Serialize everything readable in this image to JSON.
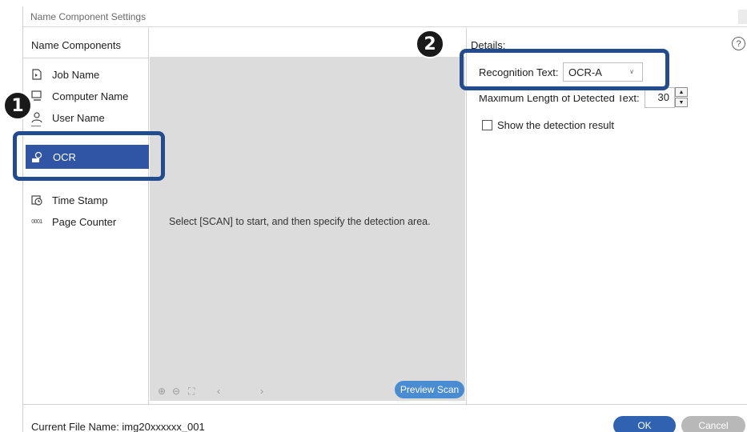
{
  "window": {
    "title": "Name Component Settings"
  },
  "left_panel": {
    "header": "Name Components",
    "items": [
      {
        "label": "Job Name",
        "icon": "document-icon"
      },
      {
        "label": "Computer Name",
        "icon": "computer-icon"
      },
      {
        "label": "User Name",
        "icon": "user-icon"
      },
      {
        "label": "OCR",
        "icon": "ocr-icon",
        "selected": true
      },
      {
        "label": "Time Stamp",
        "icon": "clock-icon"
      },
      {
        "label": "Page Counter",
        "icon": "counter-icon"
      }
    ]
  },
  "preview": {
    "message": "Select [SCAN] to start, and then specify the detection area.",
    "tools": {
      "zoom_in": "⊕",
      "zoom_out": "⊖",
      "fit": "⛶",
      "prev": "‹",
      "next": "›"
    },
    "preview_scan_label": "Preview Scan"
  },
  "details": {
    "label": "Details:",
    "help": "?",
    "recognition_text_label": "Recognition Text:",
    "recognition_text_value": "OCR-A",
    "max_length_label": "Maximum Length of Detected Text:",
    "max_length_value": "30",
    "show_detection_label": "Show the detection result",
    "show_detection_checked": false
  },
  "footer": {
    "current_file": "Current File Name: img20xxxxxx_001",
    "ok_label": "OK",
    "cancel_label": "Cancel"
  },
  "callouts": {
    "one": "1",
    "two": "2"
  },
  "colors": {
    "selection": "#2f55a4",
    "highlight": "#224c8e",
    "ok_button": "#2f63b2",
    "preview_scan": "#4a8cd2"
  }
}
